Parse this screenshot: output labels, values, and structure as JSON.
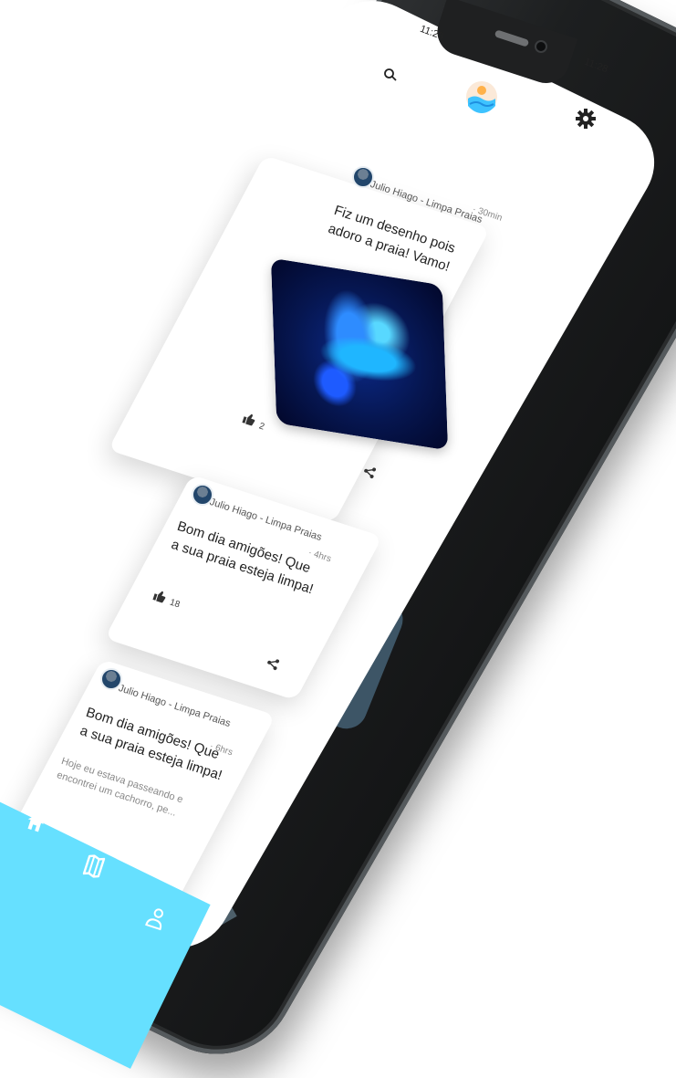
{
  "status_bar": {
    "time_left": "11:28",
    "time_right": "11:28"
  },
  "header": {
    "logo_icon": "wave-sun-logo",
    "search_icon": "search-icon",
    "settings_icon": "gear-icon"
  },
  "posts": [
    {
      "author": "Julio Hiago - Limpa Praias",
      "timestamp": "· 30min",
      "text": "Fiz um desenho pois adoro a praia! Vamo!",
      "likes": "2",
      "has_image": true
    },
    {
      "author": "Julio Hiago - Limpa Praias",
      "timestamp": "· 4hrs",
      "text": "Bom dia amigões! Que a sua praia esteja limpa!",
      "likes": "18"
    },
    {
      "author": "Julio Hiago - Limpa Praias",
      "timestamp": "· 6hrs",
      "text": "Bom dia amigões! Que a sua praia esteja limpa!",
      "preview": "Hoje eu estava passeando e encontrei um cachorro, pe..."
    }
  ],
  "nav": {
    "items": [
      "home-icon",
      "map-icon",
      "profile-icon"
    ]
  },
  "colors": {
    "accent": "#66e0ff",
    "phone_frame": "#1d1f20",
    "side_band": "#4d5f6a"
  }
}
